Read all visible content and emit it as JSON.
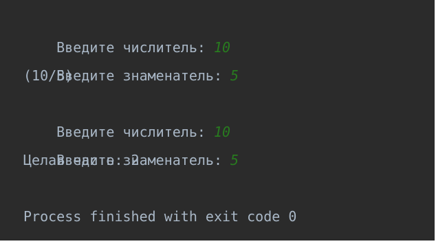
{
  "console": {
    "lines": [
      {
        "prompt": "Введите числитель: ",
        "input": "10"
      },
      {
        "prompt": "Введите знаменатель: ",
        "input": "5"
      },
      {
        "text": "(10/5)"
      },
      {
        "prompt": "Введите числитель: ",
        "input": "10"
      },
      {
        "prompt": "Введите знаменатель: ",
        "input": "5"
      },
      {
        "text": "Целая часть: 2"
      },
      {
        "text": ""
      },
      {
        "text": "Process finished with exit code 0"
      }
    ],
    "colors": {
      "background": "#2b2b2b",
      "text": "#a9b7c6",
      "input": "#287b1f"
    }
  }
}
